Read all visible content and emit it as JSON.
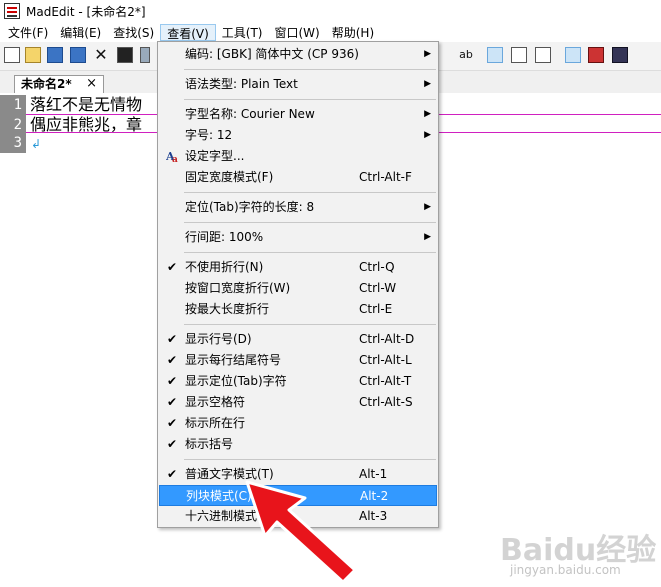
{
  "window": {
    "title": "MadEdit - [未命名2*]"
  },
  "menubar": {
    "items": [
      "文件(F)",
      "编辑(E)",
      "查找(S)",
      "查看(V)",
      "工具(T)",
      "窗口(W)",
      "帮助(H)"
    ],
    "active_index": 3
  },
  "tab": {
    "label": "未命名2*",
    "close": "×"
  },
  "editor": {
    "lines": [
      {
        "number": "1",
        "text": "落红不是无情物"
      },
      {
        "number": "2",
        "text": "偶应非熊兆，章"
      },
      {
        "number": "3",
        "text": ""
      }
    ]
  },
  "view_menu": {
    "items": [
      {
        "label": "编码: [GBK] 简体中文 (CP 936)",
        "submenu": true
      },
      {
        "label": "语法类型: Plain Text",
        "submenu": true
      },
      {
        "label": "字型名称: Courier New",
        "submenu": true
      },
      {
        "label": "字号: 12",
        "submenu": true
      },
      {
        "label": "设定字型...",
        "icon": "font-settings-icon"
      },
      {
        "label": "固定宽度模式(F)",
        "shortcut": "Ctrl-Alt-F"
      },
      {
        "label": "定位(Tab)字符的长度: 8",
        "submenu": true
      },
      {
        "label": "行间距: 100%",
        "submenu": true
      },
      {
        "label": "不使用折行(N)",
        "shortcut": "Ctrl-Q",
        "checked": true
      },
      {
        "label": "按窗口宽度折行(W)",
        "shortcut": "Ctrl-W"
      },
      {
        "label": "按最大长度折行",
        "shortcut": "Ctrl-E"
      },
      {
        "label": "显示行号(D)",
        "shortcut": "Ctrl-Alt-D",
        "checked": true
      },
      {
        "label": "显示每行结尾符号",
        "shortcut": "Ctrl-Alt-L",
        "checked": true
      },
      {
        "label": "显示定位(Tab)字符",
        "shortcut": "Ctrl-Alt-T",
        "checked": true
      },
      {
        "label": "显示空格符",
        "shortcut": "Ctrl-Alt-S",
        "checked": true
      },
      {
        "label": "标示所在行",
        "checked": true
      },
      {
        "label": "标示括号",
        "checked": true
      },
      {
        "label": "普通文字模式(T)",
        "shortcut": "Alt-1",
        "checked": true
      },
      {
        "label": "列块模式(C)",
        "shortcut": "Alt-2",
        "highlighted": true
      },
      {
        "label": "十六进制模式(",
        "shortcut": "Alt-3"
      }
    ],
    "check_mark": "✔",
    "arrow": "▶"
  },
  "watermark": {
    "text": "Baidu经验",
    "sub": "jingyan.baidu.com"
  },
  "colors": {
    "highlight": "#3399ff",
    "line_number_bg": "#8a8a8a",
    "current_line": "#d020c0",
    "annotation_arrow": "#e8141b"
  }
}
